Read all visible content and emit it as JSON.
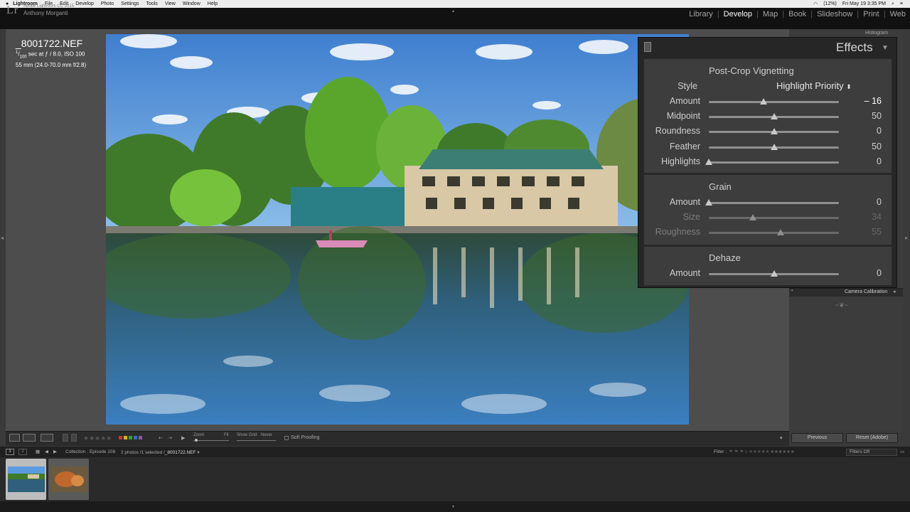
{
  "menubar": {
    "apple": "",
    "items": [
      "Lightroom",
      "File",
      "Edit",
      "Develop",
      "Photo",
      "Settings",
      "Tools",
      "View",
      "Window",
      "Help"
    ],
    "battery": "(12%)",
    "clock": "Fri May 19  3:35 PM"
  },
  "identity": {
    "logo": "Lr",
    "version": "Adobe Lightroom CC 2015",
    "user": "Anthony Morganti"
  },
  "modules": [
    "Library",
    "Develop",
    "Map",
    "Book",
    "Slideshow",
    "Print",
    "Web"
  ],
  "active_module": "Develop",
  "photo_info": {
    "filename": "_8001722.NEF",
    "exposure_prefix": "1",
    "exposure_denominator": "100",
    "exposure_rest": "sec at ƒ / 8.0, ISO 100",
    "lens": "55 mm (24.0-70.0 mm f/2.8)"
  },
  "right_panel": {
    "histogram_label": "Histogram",
    "camera_calibration_label": "Camera Calibration",
    "ornament": "~❦~"
  },
  "effects": {
    "title": "Effects",
    "vignetting": {
      "title": "Post-Crop Vignetting",
      "style_label": "Style",
      "style_value": "Highlight Priority",
      "sliders": [
        {
          "label": "Amount",
          "value": "– 16",
          "fraction": 0.42,
          "active": true
        },
        {
          "label": "Midpoint",
          "value": "50",
          "fraction": 0.5
        },
        {
          "label": "Roundness",
          "value": "0",
          "fraction": 0.5
        },
        {
          "label": "Feather",
          "value": "50",
          "fraction": 0.5
        },
        {
          "label": "Highlights",
          "value": "0",
          "fraction": 0.0
        }
      ]
    },
    "grain": {
      "title": "Grain",
      "sliders": [
        {
          "label": "Amount",
          "value": "0",
          "fraction": 0.0
        },
        {
          "label": "Size",
          "value": "34",
          "fraction": 0.34,
          "dim": true
        },
        {
          "label": "Roughness",
          "value": "55",
          "fraction": 0.55,
          "dim": true
        }
      ]
    },
    "dehaze": {
      "title": "Dehaze",
      "sliders": [
        {
          "label": "Amount",
          "value": "0",
          "fraction": 0.5
        }
      ]
    }
  },
  "toolbar": {
    "zoom_label": "Zoom",
    "zoom_value": "Fit",
    "grid_label": "Show Grid:",
    "grid_value": "Never",
    "soft_proofing": "Soft Proofing",
    "stars": "★★★★★",
    "color_labels": [
      "#c0392b",
      "#d4b51e",
      "#3f9a3c",
      "#3570b8",
      "#8e5aa8"
    ],
    "previous_button": "Previous",
    "reset_button": "Reset (Adobe)"
  },
  "filmstrip": {
    "page1": "1",
    "page2": "2",
    "collection": "Collection : Episode 109",
    "selection": "2 photos /1 selected /",
    "selected_file": "_8001722.NEF",
    "filter_label": "Filter :",
    "filter_value": "Filters Off"
  }
}
